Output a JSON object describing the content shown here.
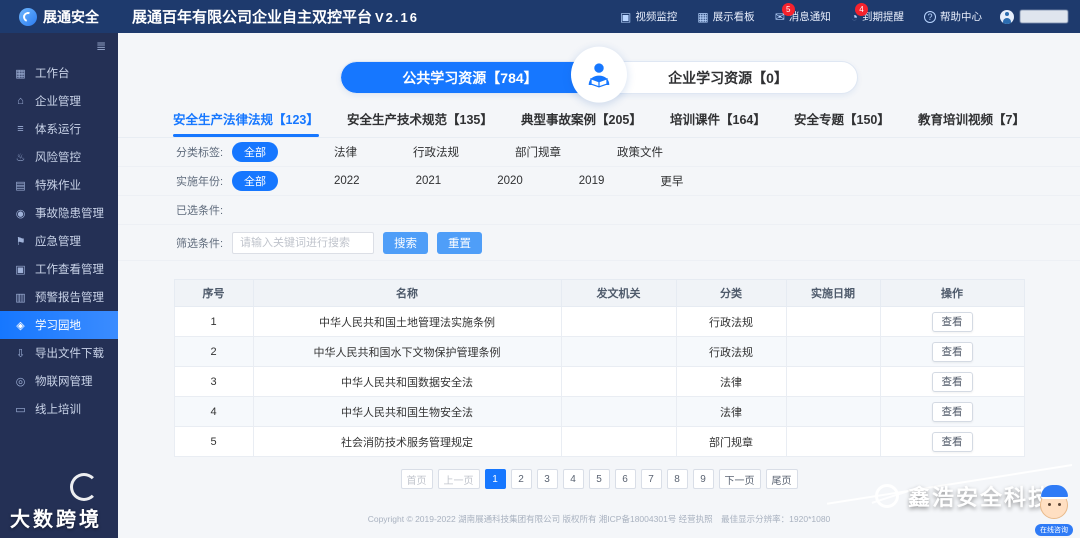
{
  "colors": {
    "accent": "#1677ff",
    "header_bg": "#1e3a6d",
    "sidebar_bg": "#243055",
    "badge_red": "#f5222d"
  },
  "header": {
    "logo_text": "展通安全",
    "title": "展通百年有限公司企业自主双控平台",
    "version": "V2.16",
    "nav": [
      {
        "label": "视频监控",
        "icon": "video-icon",
        "glyph": "▣"
      },
      {
        "label": "展示看板",
        "icon": "dashboard-icon",
        "glyph": "▦"
      },
      {
        "label": "消息通知",
        "icon": "message-icon",
        "glyph": "✉",
        "badge": "5"
      },
      {
        "label": "到期提醒",
        "icon": "reminder-clock-icon",
        "glyph": "◔",
        "badge": "4"
      },
      {
        "label": "帮助中心",
        "icon": "help-icon",
        "glyph": "?"
      }
    ]
  },
  "sidebar": {
    "items": [
      {
        "label": "工作台",
        "icon": "workbench-icon",
        "glyph": "▦"
      },
      {
        "label": "企业管理",
        "icon": "enterprise-icon",
        "glyph": "⌂"
      },
      {
        "label": "体系运行",
        "icon": "system-run-icon",
        "glyph": "≡"
      },
      {
        "label": "风险管控",
        "icon": "risk-control-icon",
        "glyph": "♨"
      },
      {
        "label": "特殊作业",
        "icon": "special-work-icon",
        "glyph": "▤"
      },
      {
        "label": "事故隐患管理",
        "icon": "hazard-icon",
        "glyph": "◉"
      },
      {
        "label": "应急管理",
        "icon": "emergency-icon",
        "glyph": "⚑"
      },
      {
        "label": "工作查看管理",
        "icon": "work-view-icon",
        "glyph": "▣"
      },
      {
        "label": "预警报告管理",
        "icon": "warning-report-icon",
        "glyph": "▥"
      },
      {
        "label": "学习园地",
        "icon": "learning-icon",
        "glyph": "◈",
        "active": true
      },
      {
        "label": "导出文件下载",
        "icon": "download-icon",
        "glyph": "⇩"
      },
      {
        "label": "物联网管理",
        "icon": "iot-icon",
        "glyph": "◎"
      },
      {
        "label": "线上培训",
        "icon": "online-training-icon",
        "glyph": "▭"
      }
    ]
  },
  "resource_tabs": [
    {
      "label": "公共学习资源",
      "count": "784",
      "active": true
    },
    {
      "label": "企业学习资源",
      "count": "0",
      "active": false
    }
  ],
  "category_tabs": [
    {
      "label": "安全生产法律法规",
      "count": "123",
      "active": true
    },
    {
      "label": "安全生产技术规范",
      "count": "135"
    },
    {
      "label": "典型事故案例",
      "count": "205"
    },
    {
      "label": "培训课件",
      "count": "164"
    },
    {
      "label": "安全专题",
      "count": "150"
    },
    {
      "label": "教育培训视频",
      "count": "7"
    }
  ],
  "filters": {
    "tag_label": "分类标签:",
    "tags": [
      {
        "label": "全部",
        "active": true
      },
      {
        "label": "法律"
      },
      {
        "label": "行政法规"
      },
      {
        "label": "部门规章"
      },
      {
        "label": "政策文件"
      }
    ],
    "year_label": "实施年份:",
    "years": [
      {
        "label": "全部",
        "active": true
      },
      {
        "label": "2022"
      },
      {
        "label": "2021"
      },
      {
        "label": "2020"
      },
      {
        "label": "2019"
      },
      {
        "label": "更早"
      }
    ],
    "selected_label": "已选条件:",
    "search_label": "筛选条件:",
    "search_placeholder": "请输入关键词进行搜索",
    "search_button": "搜索",
    "reset_button": "重置"
  },
  "table": {
    "headers": [
      "序号",
      "名称",
      "发文机关",
      "分类",
      "实施日期",
      "操作"
    ],
    "rows": [
      {
        "no": "1",
        "name": "中华人民共和国土地管理法实施条例",
        "agency": "",
        "category": "行政法规",
        "date": "",
        "action": "查看"
      },
      {
        "no": "2",
        "name": "中华人民共和国水下文物保护管理条例",
        "agency": "",
        "category": "行政法规",
        "date": "",
        "action": "查看"
      },
      {
        "no": "3",
        "name": "中华人民共和国数据安全法",
        "agency": "",
        "category": "法律",
        "date": "",
        "action": "查看"
      },
      {
        "no": "4",
        "name": "中华人民共和国生物安全法",
        "agency": "",
        "category": "法律",
        "date": "",
        "action": "查看"
      },
      {
        "no": "5",
        "name": "社会消防技术服务管理规定",
        "agency": "",
        "category": "部门规章",
        "date": "",
        "action": "查看"
      }
    ]
  },
  "pagination": {
    "items": [
      {
        "label": "首页",
        "disabled": true
      },
      {
        "label": "上一页",
        "disabled": true
      },
      {
        "label": "1",
        "active": true
      },
      {
        "label": "2"
      },
      {
        "label": "3"
      },
      {
        "label": "4"
      },
      {
        "label": "5"
      },
      {
        "label": "6"
      },
      {
        "label": "7"
      },
      {
        "label": "8"
      },
      {
        "label": "9"
      },
      {
        "label": "下一页"
      },
      {
        "label": "尾页"
      }
    ]
  },
  "footer": {
    "text": "Copyright © 2019-2022 湖南展通科技集团有限公司 版权所有 湘ICP备18004301号 经营执照　最佳显示分辨率：1920*1080"
  },
  "watermarks": {
    "left_text": "大数跨境",
    "right_text": "鑫浩安全科技"
  },
  "support": {
    "label": "在线咨询"
  }
}
